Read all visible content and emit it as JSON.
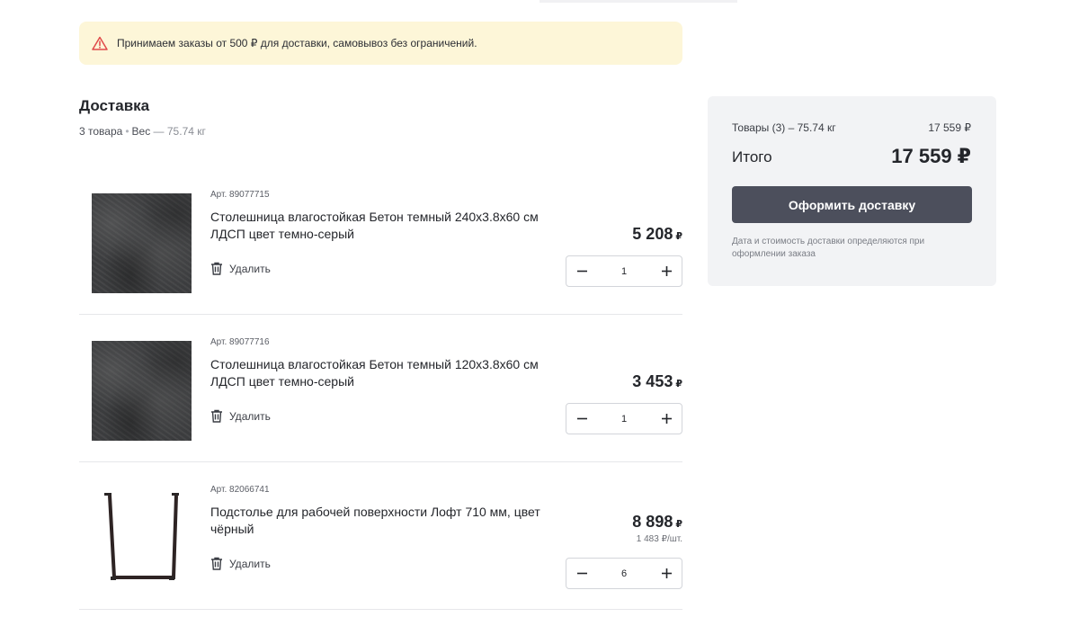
{
  "notice": {
    "text": "Принимаем заказы от 500 ₽ для доставки, самовывоз без ограничений.",
    "icon": "warning-triangle-icon",
    "icon_color": "#e04a4a",
    "background": "#fdf6d8"
  },
  "section": {
    "title": "Доставка",
    "count": "3 товара",
    "weight_label": "Вес",
    "weight_value": "— 75.74 кг"
  },
  "items": [
    {
      "art": "Арт. 89077715",
      "name": "Столешница влагостойкая Бетон темный 240x3.8x60 см ЛДСП цвет темно-серый",
      "price": "5 208",
      "currency": "₽",
      "unit_price": "",
      "quantity": "1",
      "delete_label": "Удалить",
      "image": "dark-concrete-texture"
    },
    {
      "art": "Арт. 89077716",
      "name": "Столешница влагостойкая Бетон темный 120x3.8x60 см ЛДСП цвет темно-серый",
      "price": "3 453",
      "currency": "₽",
      "unit_price": "",
      "quantity": "1",
      "delete_label": "Удалить",
      "image": "dark-concrete-texture"
    },
    {
      "art": "Арт. 82066741",
      "name": "Подстолье для рабочей поверхности Лофт 710 мм, цвет чёрный",
      "price": "8 898",
      "currency": "₽",
      "unit_price": "1 483 ₽/шт.",
      "quantity": "6",
      "delete_label": "Удалить",
      "image": "black-metal-table-leg"
    }
  ],
  "summary": {
    "goods_label": "Товары (3) – 75.74 кг",
    "goods_value": "17 559 ₽",
    "total_label": "Итого",
    "total_value": "17 559 ₽",
    "checkout_label": "Оформить доставку",
    "note": "Дата и стоимость доставки определяются при оформлении заказа",
    "button_color": "#4c4f5c",
    "panel_color": "#f2f3f5"
  }
}
